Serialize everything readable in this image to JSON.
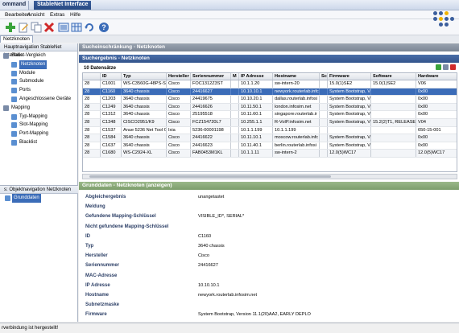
{
  "window": {
    "left_tab": "ommand",
    "active_tab": "StableNet Interface"
  },
  "menu": [
    "Bearbeiten",
    "Ansicht",
    "Extras",
    "Hilfe"
  ],
  "toolbar": {
    "icons": [
      "add-icon",
      "edit-icon",
      "copy-icon",
      "delete-icon",
      "list-icon",
      "table-icon",
      "refresh-icon",
      "help-icon"
    ]
  },
  "tabstrip": {
    "label": "Netzknoten"
  },
  "left_panel": {
    "header": "Hauptnavigation StableNet Interface",
    "items": [
      {
        "label": "Sollist-Vergleich",
        "level": 0,
        "icon": "compare-icon"
      },
      {
        "label": "Netzknoten",
        "level": 1,
        "icon": "node-icon",
        "selected": true
      },
      {
        "label": "Module",
        "level": 1,
        "icon": "module-icon"
      },
      {
        "label": "Submodule",
        "level": 1,
        "icon": "submodule-icon"
      },
      {
        "label": "Ports",
        "level": 1,
        "icon": "port-icon"
      },
      {
        "label": "Angeschlossene Geräte",
        "level": 1,
        "icon": "device-icon"
      },
      {
        "label": "Mapping",
        "level": 0,
        "icon": "mapping-icon"
      },
      {
        "label": "Typ-Mapping",
        "level": 1,
        "icon": "type-mapping-icon"
      },
      {
        "label": "Slot-Mapping",
        "level": 1,
        "icon": "slot-mapping-icon"
      },
      {
        "label": "Port-Mapping",
        "level": 1,
        "icon": "port-mapping-icon"
      },
      {
        "label": "Blacklist",
        "level": 1,
        "icon": "blacklist-icon"
      }
    ],
    "lower_header": "s: Objektnavigation Netzknoten",
    "lower_items": [
      {
        "label": "Grunddaten",
        "selected": true
      }
    ]
  },
  "filter_header": "Sucheinschränkung - Netzknoten",
  "results_header": "Suchergebnis - Netzknoten",
  "count_label": "10 Datensätze",
  "table": {
    "columns": [
      "",
      "ID",
      "Typ",
      "Hersteller",
      "Seriennummer",
      "M",
      "IP Adresse",
      "Hostname",
      "Sc",
      "Firmware",
      "Software",
      "Hardware"
    ],
    "rows": [
      [
        "28",
        "C1001",
        "WS-C3560G-48PS-S",
        "Cisco",
        "FOC1312Z3ST",
        "",
        "10.1.1.20",
        "sw-intern-20",
        "",
        "15.0(1)SE2",
        "15.0(1)SE2",
        "V06"
      ],
      [
        "28",
        "C1160",
        "3640 chassis",
        "Cisco",
        "24416627",
        "",
        "10.10.10.1",
        "newyork.routerlab.infc",
        "",
        "System Bootstrap, Ve",
        "",
        "0x00"
      ],
      [
        "28",
        "C1203",
        "3640 chassis",
        "Cisco",
        "24419675",
        "",
        "10.10.20.1",
        "dallas.routerlab.infosi",
        "",
        "System Bootstrap, Ve",
        "",
        "0x00"
      ],
      [
        "28",
        "C1249",
        "3640 chassis",
        "Cisco",
        "24416626",
        "",
        "10.11.50.1",
        "london.infosim.net",
        "",
        "System Bootstrap, Ve",
        "",
        "0x00"
      ],
      [
        "28",
        "C1312",
        "3640 chassis",
        "Cisco",
        "25195518",
        "",
        "10.11.60.1",
        "singapore.routerlab.ir",
        "",
        "System Bootstrap, Ve",
        "",
        "0x00"
      ],
      [
        "28",
        "C1348",
        "CISCO2951/K9",
        "Cisco",
        "FCZ154720L7",
        "",
        "10.255.1.1",
        "R-VoIP.infosim.net",
        "",
        "System Bootstrap, Ve",
        "15.2(2)T1, RELEASE S",
        "V04"
      ],
      [
        "28",
        "C1537",
        "Anue 5236 Net Tool O",
        "Ixia",
        "5236-00001198",
        "",
        "10.1.1.199",
        "10.1.1.199",
        "",
        "",
        "",
        "650-15-001"
      ],
      [
        "28",
        "C1584",
        "3640 chassis",
        "Cisco",
        "24416622",
        "",
        "10.11.10.1",
        "moscow.routerlab.infc",
        "",
        "System Bootstrap, Ve",
        "",
        "0x00"
      ],
      [
        "28",
        "C1637",
        "3640 chassis",
        "Cisco",
        "24416623",
        "",
        "10.11.40.1",
        "berlin.routerlab.infosi",
        "",
        "System Bootstrap, Ve",
        "",
        "0x00"
      ],
      [
        "28",
        "C1680",
        "WS-C2924-XL",
        "Cisco",
        "FAB0453M1KL",
        "",
        "10.1.1.11",
        "sw-intern-2",
        "",
        "12.0(5)WC17",
        "",
        "12.0(5)WC17"
      ]
    ],
    "selected_row": 1
  },
  "details_header": "Grunddaten - Netzknoten (anzeigen)",
  "details": [
    {
      "label": "Abgleichergebnis",
      "value": "unangetastet"
    },
    {
      "label": "Meldung",
      "value": ""
    },
    {
      "label": "Gefundene Mapping-Schlüssel",
      "value": "VISIBLE_ID*, SERIAL*"
    },
    {
      "label": "Nicht gefundene Mapping-Schlüssel",
      "value": ""
    },
    {
      "label": "ID",
      "value": "C1160"
    },
    {
      "label": "Typ",
      "value": "3640 chassis"
    },
    {
      "label": "Hersteller",
      "value": "Cisco"
    },
    {
      "label": "Seriennummer",
      "value": "24416627"
    },
    {
      "label": "MAC-Adresse",
      "value": ""
    },
    {
      "label": "IP Adresse",
      "value": "10.10.10.1"
    },
    {
      "label": "Hostname",
      "value": "newyork.routerlab.infosim.net"
    },
    {
      "label": "Subnetzmaske",
      "value": ""
    },
    {
      "label": "Firmware",
      "value": "System Bootstrap, Version 11.1(20)AA2, EARLY DEPLO"
    }
  ],
  "status": "rverbindung ist hergestellt!",
  "colors": {
    "selection": "#3b6cb8",
    "header_blue": "#3b5e9c",
    "header_green": "#9ab889"
  }
}
